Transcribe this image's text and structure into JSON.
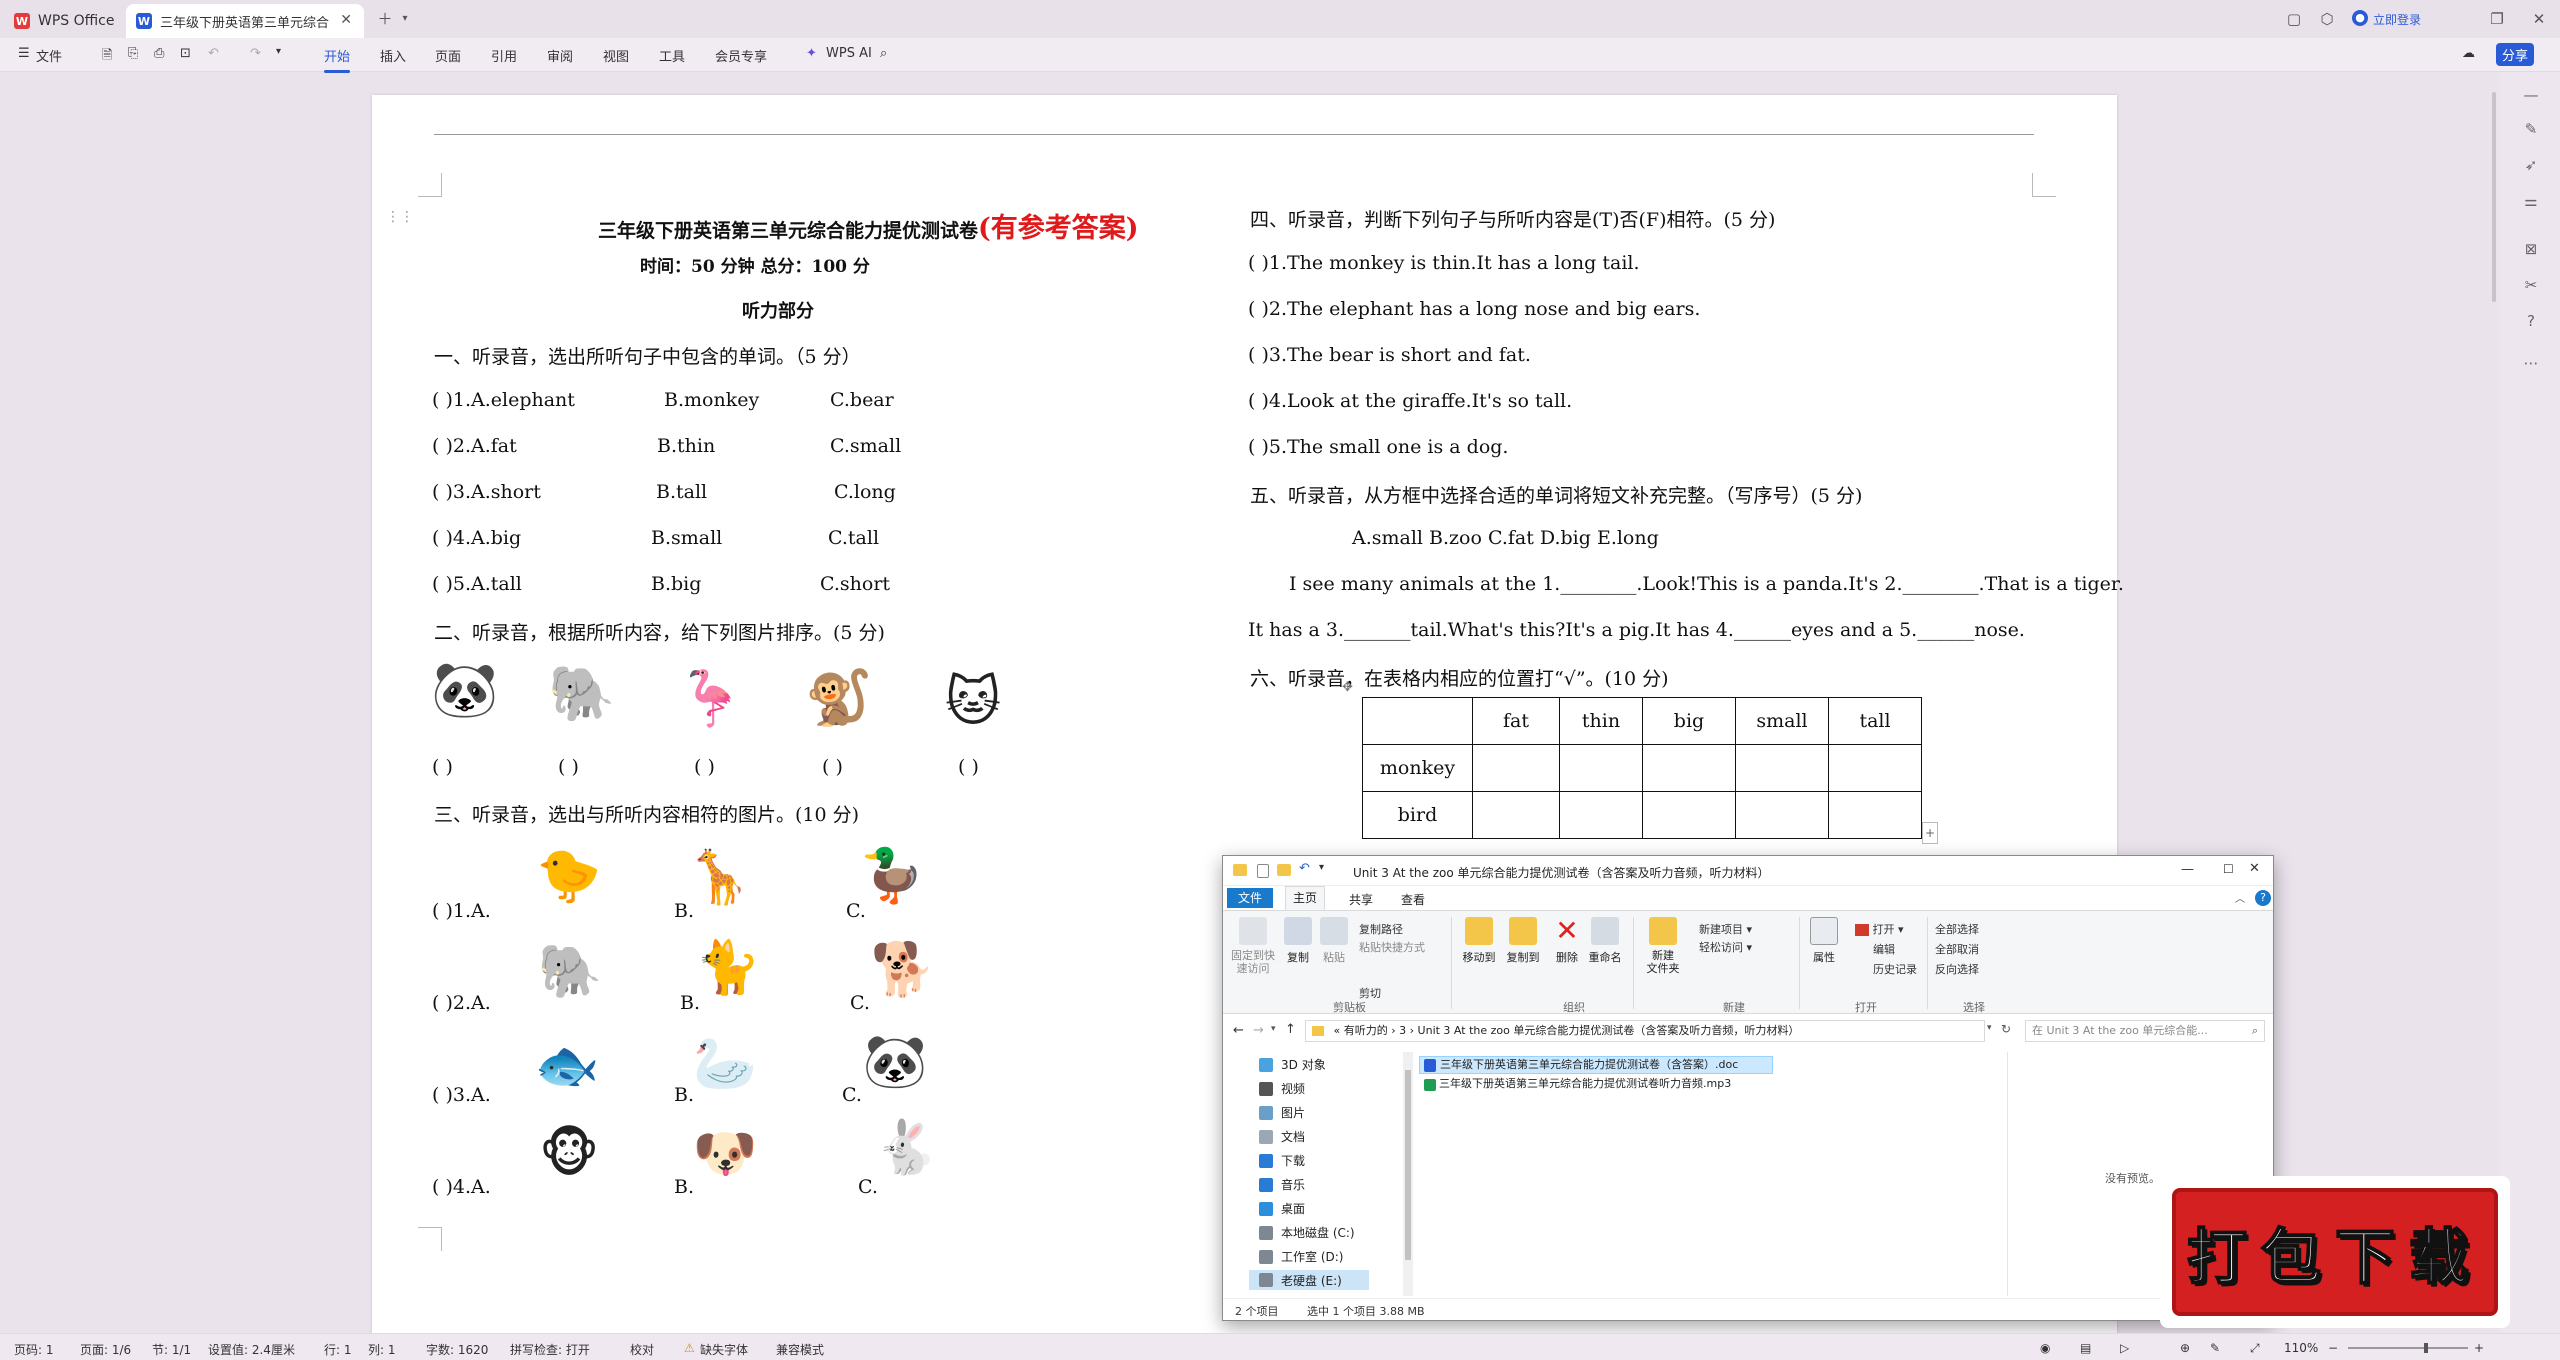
{
  "titlebar": {
    "app_tab": "WPS Office",
    "doc_tab": "三年级下册英语第三单元综合",
    "login": "立即登录"
  },
  "ribbon": {
    "file_menu": "文件",
    "tabs": [
      "开始",
      "插入",
      "页面",
      "引用",
      "审阅",
      "视图",
      "工具",
      "会员专享"
    ],
    "ai": "WPS AI",
    "share": "分享"
  },
  "doc": {
    "title_black": "三年级下册英语第三单元综合能力提优测试卷",
    "title_red": "(有参考答案)",
    "subtitle": "时间：50 分钟      总分：100 分",
    "section_listen": "听力部分",
    "q1_head": "一、听录音，选出所听句子中包含的单词。（5 分）",
    "q1_items": [
      {
        "num": "(        )1.A.elephant",
        "b": "B.monkey",
        "c": "C.bear"
      },
      {
        "num": "(        )2.A.fat",
        "b": "B.thin",
        "c": "C.small"
      },
      {
        "num": "(        )3.A.short",
        "b": "B.tall",
        "c": "C.long"
      },
      {
        "num": "(        )4.A.big",
        "b": "B.small",
        "c": "C.tall"
      },
      {
        "num": "(        )5.A.tall",
        "b": "B.big",
        "c": "C.short"
      }
    ],
    "q2_head": "二、听录音，根据所听内容，给下列图片排序。(5 分)",
    "q2_paren": "(        )",
    "q3_head": "三、听录音，选出与所听内容相符的图片。(10 分)",
    "q3_items": [
      {
        "a": "(        )1.A.",
        "b": "B.",
        "c": "C."
      },
      {
        "a": "(        )2.A.",
        "b": "B.",
        "c": "C."
      },
      {
        "a": "(        )3.A.",
        "b": "B.",
        "c": "C."
      },
      {
        "a": "(        )4.A.",
        "b": "B.",
        "c": "C."
      }
    ],
    "q4_head": "四、听录音，判断下列句子与所听内容是(T)否(F)相符。(5 分)",
    "q4_items": [
      "(        )1.The monkey is thin.It has a long tail.",
      "(        )2.The elephant has a long nose and big ears.",
      "(        )3.The bear is short and fat.",
      "(        )4.Look at the giraffe.It's so tall.",
      "(        )5.The small one is a dog."
    ],
    "q5_head": "五、听录音，从方框中选择合适的单词将短文补充完整。（写序号）(5 分)",
    "q5_options": "A.small    B.zoo    C.fat    D.big    E.long",
    "q5_line1": "I see many animals at the 1.________.Look!This is a panda.It's 2.________.That is a tiger.",
    "q5_line2": "It has a 3._______tail.What's this?It's a pig.It has 4.______eyes and a 5.______nose.",
    "q6_head": "六、听录音，在表格内相应的位置打“√”。(10 分)",
    "table_headers": [
      "",
      "fat",
      "thin",
      "big",
      "small",
      "tall"
    ],
    "table_rows": [
      "monkey",
      "bird"
    ]
  },
  "explorer": {
    "title": "Unit 3 At the zoo 单元综合能力提优测试卷（含答案及听力音频，听力材料）",
    "tabs": [
      "文件",
      "主页",
      "共享",
      "查看"
    ],
    "ribbon": {
      "pin": "固定到快\n速访问",
      "copy": "复制",
      "paste": "粘贴",
      "copy_path": "复制路径",
      "paste_shortcut": "粘贴快捷方式",
      "cut": "剪切",
      "clipboard": "剪贴板",
      "move_to": "移动到",
      "copy_to": "复制到",
      "delete": "删除",
      "rename": "重命名",
      "organize": "组织",
      "new_folder": "新建\n文件夹",
      "new_item": "新建项目",
      "easy_access": "轻松访问",
      "new_group": "新建",
      "properties": "属性",
      "open": "打开",
      "edit": "编辑",
      "history": "历史记录",
      "open_group": "打开",
      "select_all": "全部选择",
      "select_none": "全部取消",
      "invert": "反向选择",
      "select_group": "选择"
    },
    "address": [
      "«",
      "有听力的",
      "›",
      "3",
      "›",
      "Unit 3 At the zoo 单元综合能力提优测试卷（含答案及听力音频，听力材料）"
    ],
    "search_placeholder": "在 Unit 3 At the zoo 单元综合能...",
    "nav": [
      "3D 对象",
      "视频",
      "图片",
      "文档",
      "下载",
      "音乐",
      "桌面",
      "本地磁盘 (C:)",
      "工作室 (D:)",
      "老硬盘 (E:)"
    ],
    "files": [
      "三年级下册英语第三单元综合能力提优测试卷（含答案）.doc",
      "三年级下册英语第三单元综合能力提优测试卷听力音频.mp3"
    ],
    "no_preview": "没有预览。",
    "status_count": "2 个项目",
    "status_selected": "选中 1 个项目  3.88 MB"
  },
  "statusbar": {
    "page_num": "页码: 1",
    "pages": "页面: 1/6",
    "section": "节: 1/1",
    "setting": "设置值: 2.4厘米",
    "row": "行: 1",
    "col": "列: 1",
    "words": "字数: 1620",
    "spell": "拼写检查: 打开",
    "proof": "校对",
    "missing_font": "缺失字体",
    "compat": "兼容模式",
    "zoom": "110%"
  },
  "promo": "打包下载",
  "colors": {
    "accent": "#2a5bd7",
    "title_red": "#e0191b",
    "promo_red": "#d42020"
  }
}
